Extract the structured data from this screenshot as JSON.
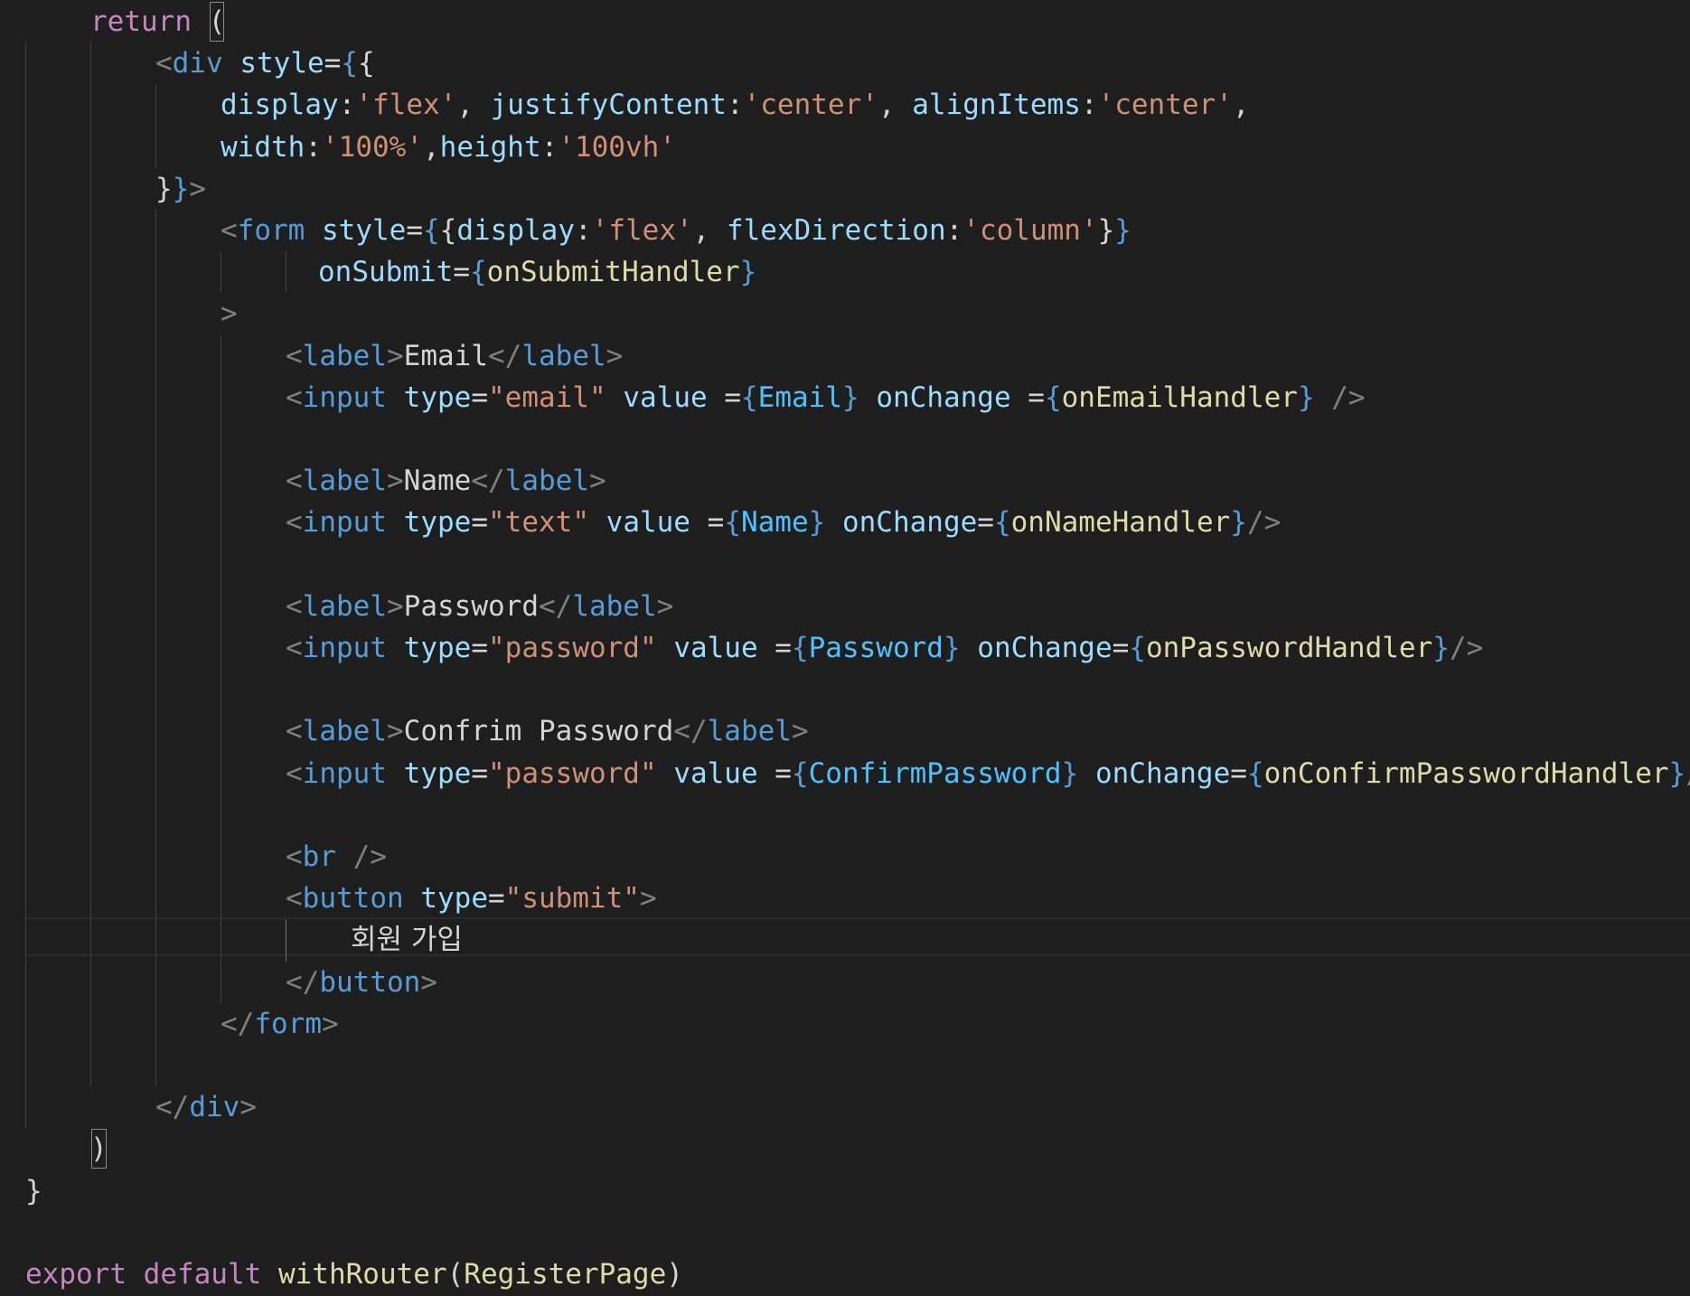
{
  "editor": {
    "theme_colors": {
      "background": "#1e1e1e",
      "keyword": "#c586c0",
      "tag": "#569cd6",
      "attribute": "#9cdcfe",
      "string": "#ce9178",
      "function": "#dcdcaa",
      "text": "#d4d4d4",
      "punctuation": "#808080"
    },
    "lines": [
      {
        "tokens": [
          {
            "t": "return",
            "c": "kw"
          },
          {
            "t": " ",
            "c": "txt"
          },
          {
            "t": "(",
            "c": "txt",
            "box": true
          }
        ]
      },
      {
        "tokens": [
          {
            "t": "<",
            "c": "punc"
          },
          {
            "t": "div",
            "c": "tag"
          },
          {
            "t": " ",
            "c": "txt"
          },
          {
            "t": "style",
            "c": "attr"
          },
          {
            "t": "=",
            "c": "txt"
          },
          {
            "t": "{",
            "c": "tag"
          },
          {
            "t": "{",
            "c": "txt"
          }
        ]
      },
      {
        "tokens": [
          {
            "t": "display",
            "c": "attr"
          },
          {
            "t": ":",
            "c": "txt"
          },
          {
            "t": "'flex'",
            "c": "str"
          },
          {
            "t": ", ",
            "c": "txt"
          },
          {
            "t": "justifyContent",
            "c": "attr"
          },
          {
            "t": ":",
            "c": "txt"
          },
          {
            "t": "'center'",
            "c": "str"
          },
          {
            "t": ", ",
            "c": "txt"
          },
          {
            "t": "alignItems",
            "c": "attr"
          },
          {
            "t": ":",
            "c": "txt"
          },
          {
            "t": "'center'",
            "c": "str"
          },
          {
            "t": ",",
            "c": "txt"
          }
        ]
      },
      {
        "tokens": [
          {
            "t": "width",
            "c": "attr"
          },
          {
            "t": ":",
            "c": "txt"
          },
          {
            "t": "'100%'",
            "c": "str"
          },
          {
            "t": ",",
            "c": "txt"
          },
          {
            "t": "height",
            "c": "attr"
          },
          {
            "t": ":",
            "c": "txt"
          },
          {
            "t": "'100vh'",
            "c": "str"
          }
        ]
      },
      {
        "tokens": [
          {
            "t": "}",
            "c": "txt"
          },
          {
            "t": "}",
            "c": "tag"
          },
          {
            "t": ">",
            "c": "punc"
          }
        ]
      },
      {
        "tokens": [
          {
            "t": "<",
            "c": "punc"
          },
          {
            "t": "form",
            "c": "tag"
          },
          {
            "t": " ",
            "c": "txt"
          },
          {
            "t": "style",
            "c": "attr"
          },
          {
            "t": "=",
            "c": "txt"
          },
          {
            "t": "{",
            "c": "tag"
          },
          {
            "t": "{",
            "c": "txt"
          },
          {
            "t": "display",
            "c": "attr"
          },
          {
            "t": ":",
            "c": "txt"
          },
          {
            "t": "'flex'",
            "c": "str"
          },
          {
            "t": ", ",
            "c": "txt"
          },
          {
            "t": "flexDirection",
            "c": "attr"
          },
          {
            "t": ":",
            "c": "txt"
          },
          {
            "t": "'column'",
            "c": "str"
          },
          {
            "t": "}",
            "c": "txt"
          },
          {
            "t": "}",
            "c": "tag"
          }
        ]
      },
      {
        "tokens": [
          {
            "t": "onSubmit",
            "c": "attr"
          },
          {
            "t": "=",
            "c": "txt"
          },
          {
            "t": "{",
            "c": "tag"
          },
          {
            "t": "onSubmitHandler",
            "c": "fn"
          },
          {
            "t": "}",
            "c": "tag"
          }
        ]
      },
      {
        "tokens": [
          {
            "t": ">",
            "c": "punc"
          }
        ]
      },
      {
        "tokens": [
          {
            "t": "<",
            "c": "punc"
          },
          {
            "t": "label",
            "c": "tag"
          },
          {
            "t": ">",
            "c": "punc"
          },
          {
            "t": "Email",
            "c": "txt"
          },
          {
            "t": "</",
            "c": "punc"
          },
          {
            "t": "label",
            "c": "tag"
          },
          {
            "t": ">",
            "c": "punc"
          }
        ]
      },
      {
        "tokens": [
          {
            "t": "<",
            "c": "punc"
          },
          {
            "t": "input",
            "c": "tag"
          },
          {
            "t": " ",
            "c": "txt"
          },
          {
            "t": "type",
            "c": "attr"
          },
          {
            "t": "=",
            "c": "txt"
          },
          {
            "t": "\"email\"",
            "c": "str"
          },
          {
            "t": " ",
            "c": "txt"
          },
          {
            "t": "value",
            "c": "attr"
          },
          {
            "t": " =",
            "c": "txt"
          },
          {
            "t": "{",
            "c": "tag"
          },
          {
            "t": "Email",
            "c": "var"
          },
          {
            "t": "}",
            "c": "tag"
          },
          {
            "t": " ",
            "c": "txt"
          },
          {
            "t": "onChange",
            "c": "attr"
          },
          {
            "t": " =",
            "c": "txt"
          },
          {
            "t": "{",
            "c": "tag"
          },
          {
            "t": "onEmailHandler",
            "c": "fn"
          },
          {
            "t": "}",
            "c": "tag"
          },
          {
            "t": " />",
            "c": "punc"
          }
        ]
      },
      {
        "tokens": []
      },
      {
        "tokens": [
          {
            "t": "<",
            "c": "punc"
          },
          {
            "t": "label",
            "c": "tag"
          },
          {
            "t": ">",
            "c": "punc"
          },
          {
            "t": "Name",
            "c": "txt"
          },
          {
            "t": "</",
            "c": "punc"
          },
          {
            "t": "label",
            "c": "tag"
          },
          {
            "t": ">",
            "c": "punc"
          }
        ]
      },
      {
        "tokens": [
          {
            "t": "<",
            "c": "punc"
          },
          {
            "t": "input",
            "c": "tag"
          },
          {
            "t": " ",
            "c": "txt"
          },
          {
            "t": "type",
            "c": "attr"
          },
          {
            "t": "=",
            "c": "txt"
          },
          {
            "t": "\"text\"",
            "c": "str"
          },
          {
            "t": " ",
            "c": "txt"
          },
          {
            "t": "value",
            "c": "attr"
          },
          {
            "t": " =",
            "c": "txt"
          },
          {
            "t": "{",
            "c": "tag"
          },
          {
            "t": "Name",
            "c": "var"
          },
          {
            "t": "}",
            "c": "tag"
          },
          {
            "t": " ",
            "c": "txt"
          },
          {
            "t": "onChange",
            "c": "attr"
          },
          {
            "t": "=",
            "c": "txt"
          },
          {
            "t": "{",
            "c": "tag"
          },
          {
            "t": "onNameHandler",
            "c": "fn"
          },
          {
            "t": "}",
            "c": "tag"
          },
          {
            "t": "/>",
            "c": "punc"
          }
        ]
      },
      {
        "tokens": []
      },
      {
        "tokens": [
          {
            "t": "<",
            "c": "punc"
          },
          {
            "t": "label",
            "c": "tag"
          },
          {
            "t": ">",
            "c": "punc"
          },
          {
            "t": "Password",
            "c": "txt"
          },
          {
            "t": "</",
            "c": "punc"
          },
          {
            "t": "label",
            "c": "tag"
          },
          {
            "t": ">",
            "c": "punc"
          }
        ]
      },
      {
        "tokens": [
          {
            "t": "<",
            "c": "punc"
          },
          {
            "t": "input",
            "c": "tag"
          },
          {
            "t": " ",
            "c": "txt"
          },
          {
            "t": "type",
            "c": "attr"
          },
          {
            "t": "=",
            "c": "txt"
          },
          {
            "t": "\"password\"",
            "c": "str"
          },
          {
            "t": " ",
            "c": "txt"
          },
          {
            "t": "value",
            "c": "attr"
          },
          {
            "t": " =",
            "c": "txt"
          },
          {
            "t": "{",
            "c": "tag"
          },
          {
            "t": "Password",
            "c": "var"
          },
          {
            "t": "}",
            "c": "tag"
          },
          {
            "t": " ",
            "c": "txt"
          },
          {
            "t": "onChange",
            "c": "attr"
          },
          {
            "t": "=",
            "c": "txt"
          },
          {
            "t": "{",
            "c": "tag"
          },
          {
            "t": "onPasswordHandler",
            "c": "fn"
          },
          {
            "t": "}",
            "c": "tag"
          },
          {
            "t": "/>",
            "c": "punc"
          }
        ]
      },
      {
        "tokens": []
      },
      {
        "tokens": [
          {
            "t": "<",
            "c": "punc"
          },
          {
            "t": "label",
            "c": "tag"
          },
          {
            "t": ">",
            "c": "punc"
          },
          {
            "t": "Confrim Password",
            "c": "txt"
          },
          {
            "t": "</",
            "c": "punc"
          },
          {
            "t": "label",
            "c": "tag"
          },
          {
            "t": ">",
            "c": "punc"
          }
        ]
      },
      {
        "tokens": [
          {
            "t": "<",
            "c": "punc"
          },
          {
            "t": "input",
            "c": "tag"
          },
          {
            "t": " ",
            "c": "txt"
          },
          {
            "t": "type",
            "c": "attr"
          },
          {
            "t": "=",
            "c": "txt"
          },
          {
            "t": "\"password\"",
            "c": "str"
          },
          {
            "t": " ",
            "c": "txt"
          },
          {
            "t": "value",
            "c": "attr"
          },
          {
            "t": " =",
            "c": "txt"
          },
          {
            "t": "{",
            "c": "tag"
          },
          {
            "t": "ConfirmPassword",
            "c": "var"
          },
          {
            "t": "}",
            "c": "tag"
          },
          {
            "t": " ",
            "c": "txt"
          },
          {
            "t": "onChange",
            "c": "attr"
          },
          {
            "t": "=",
            "c": "txt"
          },
          {
            "t": "{",
            "c": "tag"
          },
          {
            "t": "onConfirmPasswordHandler",
            "c": "fn"
          },
          {
            "t": "}",
            "c": "tag"
          },
          {
            "t": "/>",
            "c": "punc"
          }
        ]
      },
      {
        "tokens": []
      },
      {
        "tokens": [
          {
            "t": "<",
            "c": "punc"
          },
          {
            "t": "br",
            "c": "tag"
          },
          {
            "t": " />",
            "c": "punc"
          }
        ]
      },
      {
        "tokens": [
          {
            "t": "<",
            "c": "punc"
          },
          {
            "t": "button",
            "c": "tag"
          },
          {
            "t": " ",
            "c": "txt"
          },
          {
            "t": "type",
            "c": "attr"
          },
          {
            "t": "=",
            "c": "txt"
          },
          {
            "t": "\"submit\"",
            "c": "str"
          },
          {
            "t": ">",
            "c": "punc"
          }
        ]
      },
      {
        "tokens": [
          {
            "t": "회원 가입",
            "c": "txt",
            "ko": true
          }
        ]
      },
      {
        "tokens": [
          {
            "t": "</",
            "c": "punc"
          },
          {
            "t": "button",
            "c": "tag"
          },
          {
            "t": ">",
            "c": "punc"
          }
        ]
      },
      {
        "tokens": [
          {
            "t": "</",
            "c": "punc"
          },
          {
            "t": "form",
            "c": "tag"
          },
          {
            "t": ">",
            "c": "punc"
          }
        ]
      },
      {
        "tokens": []
      },
      {
        "tokens": [
          {
            "t": "</",
            "c": "punc"
          },
          {
            "t": "div",
            "c": "tag"
          },
          {
            "t": ">",
            "c": "punc"
          }
        ]
      },
      {
        "tokens": [
          {
            "t": ")",
            "c": "txt",
            "box": true
          }
        ]
      },
      {
        "tokens": [
          {
            "t": "}",
            "c": "txt"
          }
        ]
      },
      {
        "tokens": []
      },
      {
        "tokens": [
          {
            "t": "export",
            "c": "kw"
          },
          {
            "t": " ",
            "c": "txt"
          },
          {
            "t": "default",
            "c": "kw"
          },
          {
            "t": " ",
            "c": "txt"
          },
          {
            "t": "withRouter",
            "c": "fn"
          },
          {
            "t": "(",
            "c": "txt"
          },
          {
            "t": "RegisterPage",
            "c": "fn"
          },
          {
            "t": ")",
            "c": "txt"
          }
        ]
      }
    ]
  }
}
